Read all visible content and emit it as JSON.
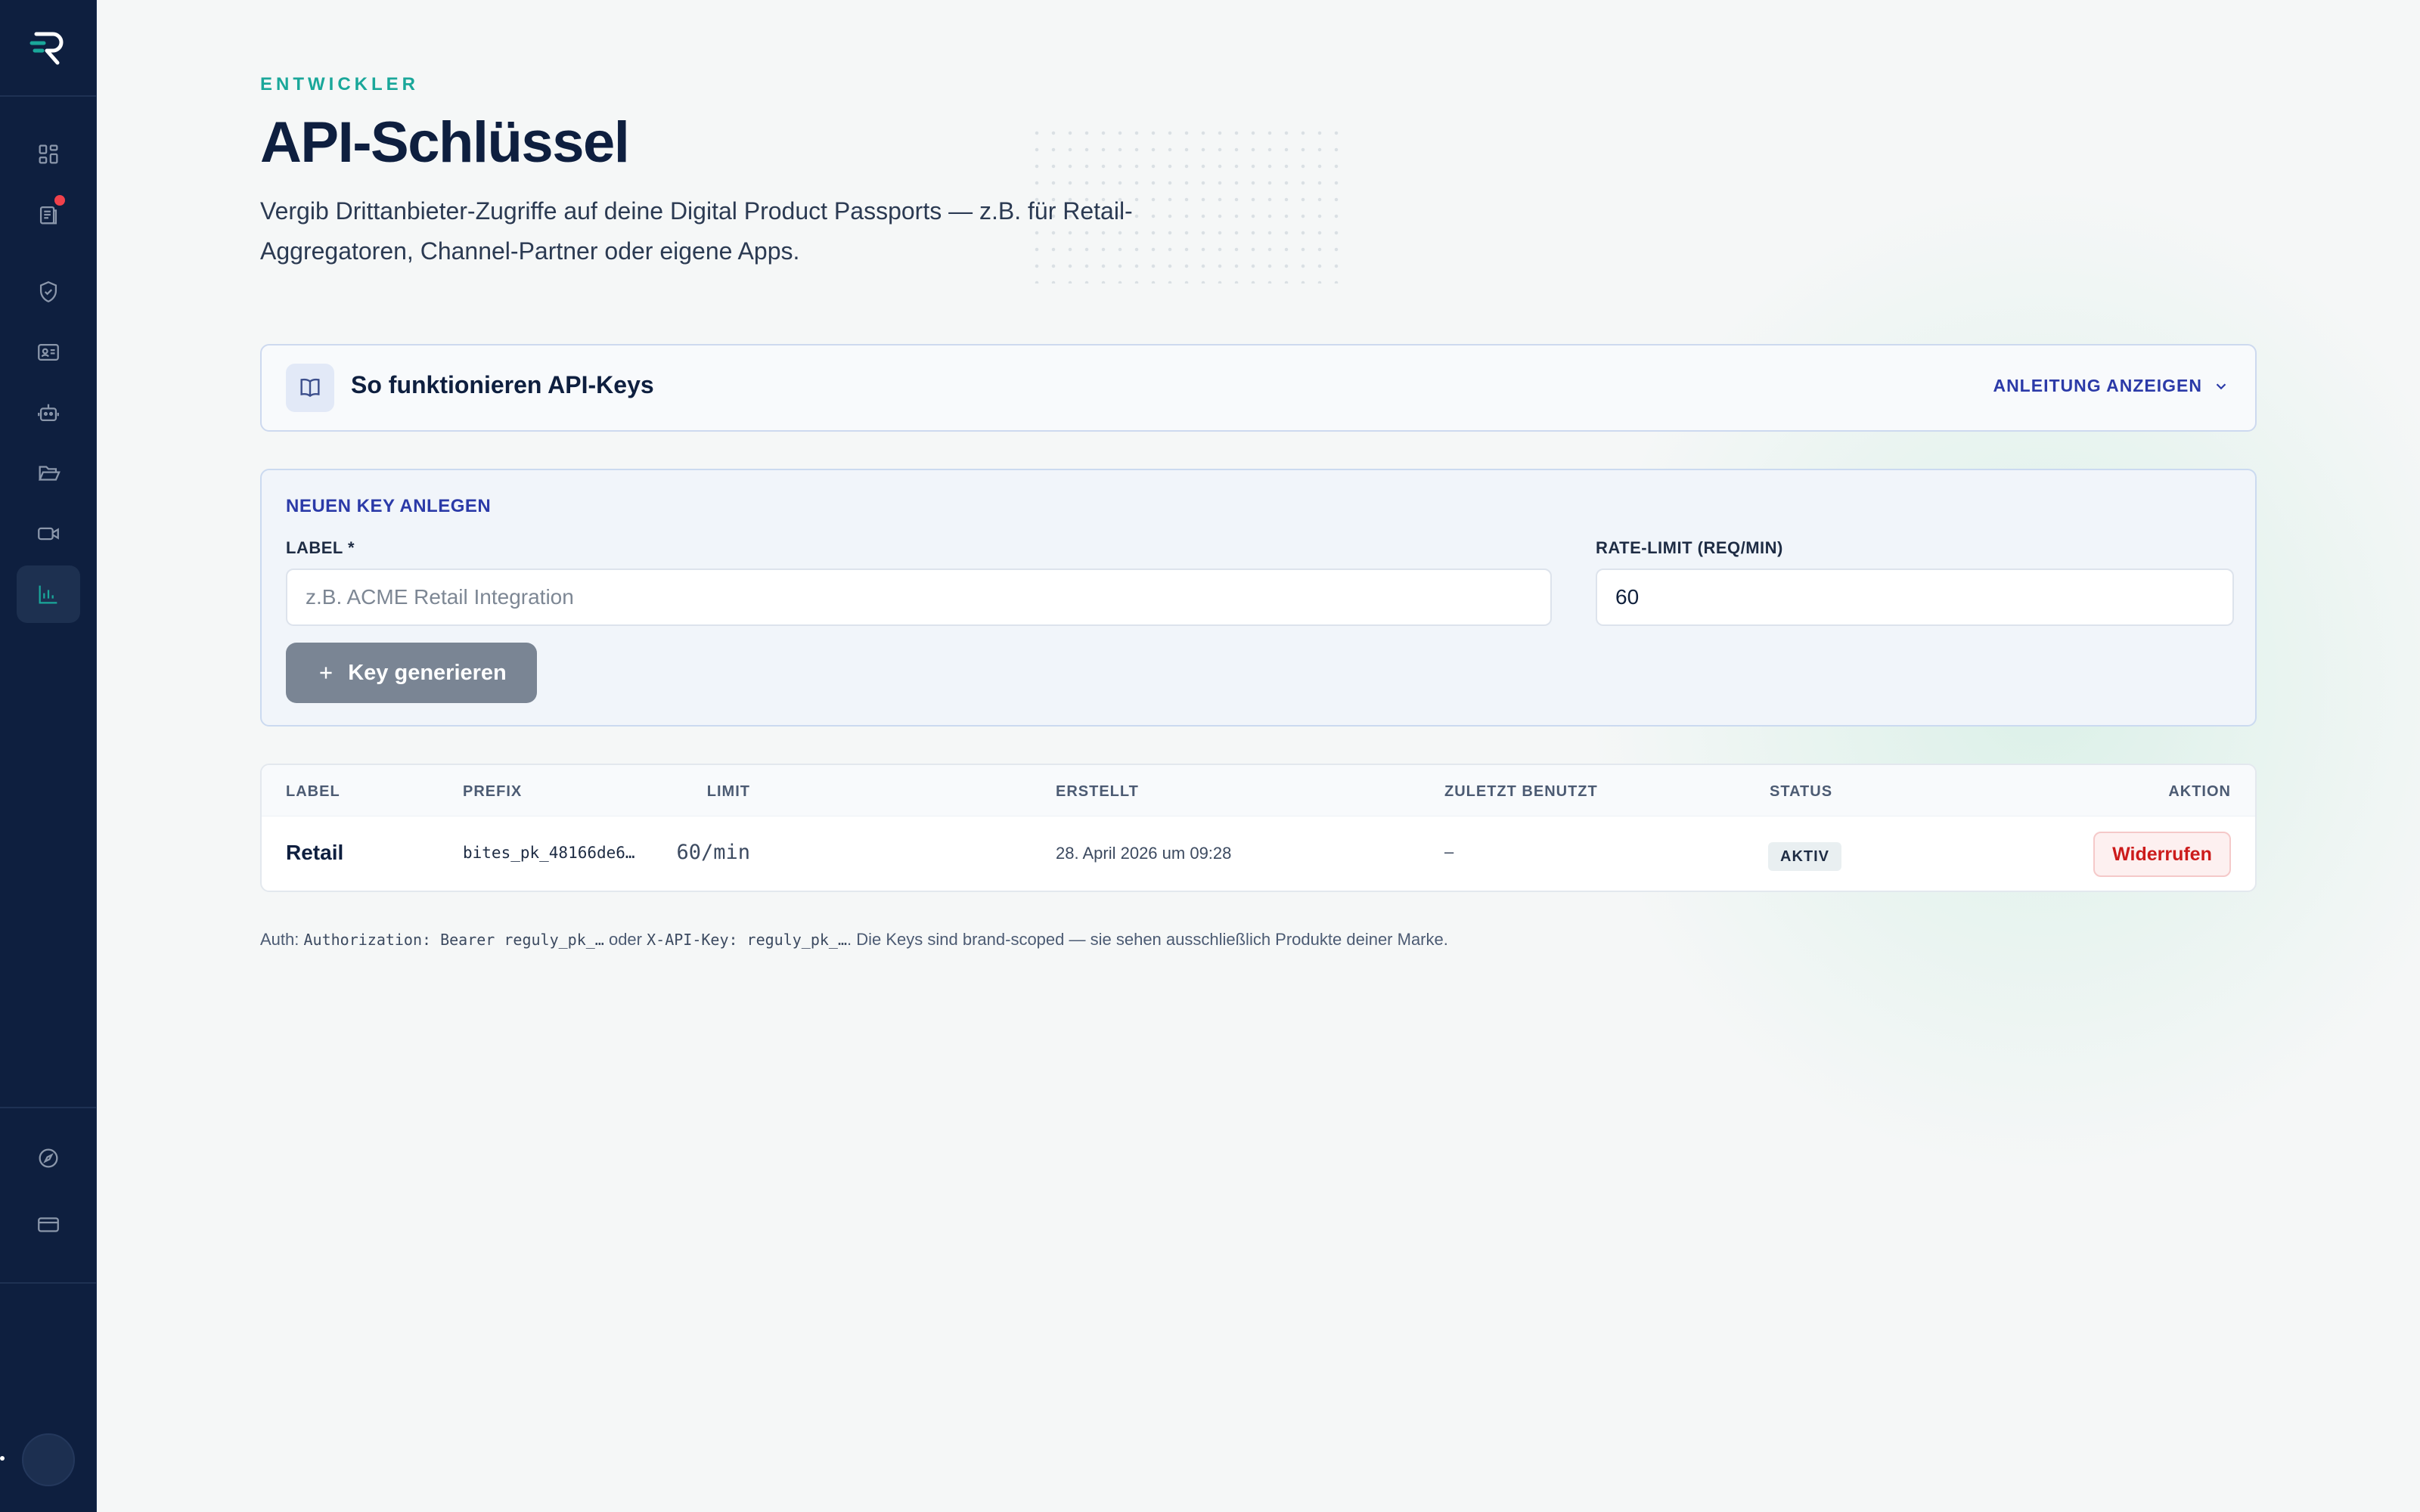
{
  "colors": {
    "sidebar_bg": "#0e1f3f",
    "accent_teal": "#1aa79a",
    "accent_blue": "#2b3aa8",
    "danger": "#cc1b1b",
    "notification": "#f0414b"
  },
  "sidebar": {
    "logo_icon": "brand-r-logo",
    "items": [
      {
        "icon": "dashboard-grid-icon",
        "active": false
      },
      {
        "icon": "clipboard-list-icon",
        "active": false,
        "has_notification": true
      },
      {
        "icon": "shield-check-icon",
        "active": false
      },
      {
        "icon": "id-card-icon",
        "active": false
      },
      {
        "icon": "robot-icon",
        "active": false
      },
      {
        "icon": "folder-open-icon",
        "active": false
      },
      {
        "icon": "video-camera-icon",
        "active": false
      },
      {
        "icon": "bar-chart-icon",
        "active": true
      }
    ],
    "bottom_items": [
      {
        "icon": "compass-icon"
      },
      {
        "icon": "credit-card-icon"
      }
    ]
  },
  "header": {
    "eyebrow": "ENTWICKLER",
    "title": "API-Schlüssel",
    "description": "Vergib Drittanbieter-Zugriffe auf deine Digital Product Passports — z.B. für Retail-Aggregatoren, Channel-Partner oder eigene Apps."
  },
  "guide": {
    "title": "So funktionieren API-Keys",
    "toggle_label": "ANLEITUNG ANZEIGEN"
  },
  "create_form": {
    "heading": "NEUEN KEY ANLEGEN",
    "label_field": {
      "label": "LABEL *",
      "placeholder": "z.B. ACME Retail Integration",
      "value": ""
    },
    "rate_field": {
      "label": "RATE-LIMIT (REQ/MIN)",
      "value": "60"
    },
    "submit_label": "Key generieren"
  },
  "table": {
    "headers": {
      "label": "LABEL",
      "prefix": "PREFIX",
      "limit": "LIMIT",
      "created": "ERSTELLT",
      "last_used": "ZULETZT BENUTZT",
      "status": "STATUS",
      "action": "AKTION"
    },
    "rows": [
      {
        "label": "Retail",
        "prefix": "bites_pk_48166de6…",
        "limit": "60/min",
        "created": "28. April 2026 um 09:28",
        "last_used": "–",
        "status": "AKTIV",
        "action": "Widerrufen"
      }
    ]
  },
  "footnote": {
    "prefix": "Auth: ",
    "code1": "Authorization: Bearer reguly_pk_…",
    "middle": " oder ",
    "code2": "X-API-Key: reguly_pk_…",
    "suffix": ". Die Keys sind brand-scoped — sie sehen ausschließlich Produkte deiner Marke."
  }
}
